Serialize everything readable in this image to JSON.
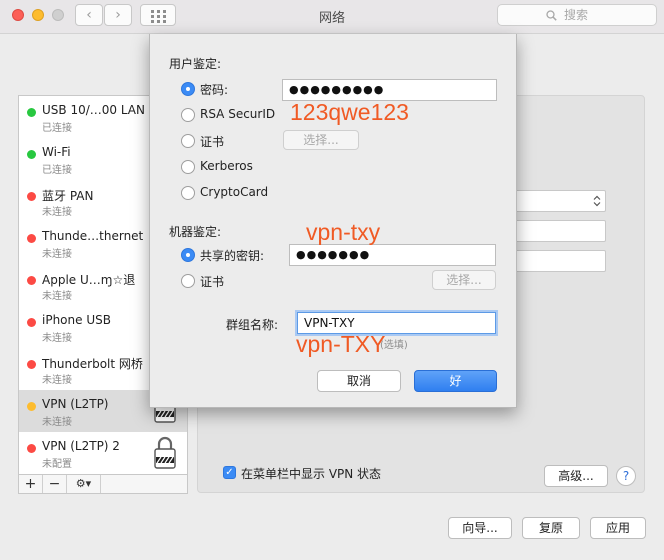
{
  "window": {
    "title": "网络",
    "search_placeholder": "搜索"
  },
  "services": [
    {
      "name": "USB 10/…00 LAN",
      "status": "已连接",
      "color": "#28c840"
    },
    {
      "name": "Wi-Fi",
      "status": "已连接",
      "color": "#28c840"
    },
    {
      "name": "蓝牙 PAN",
      "status": "未连接",
      "color": "#fc4a44"
    },
    {
      "name": "Thunde…thernet",
      "status": "未连接",
      "color": "#fc4a44"
    },
    {
      "name": "Apple U…ɱ☆退",
      "status": "未连接",
      "color": "#fc4a44"
    },
    {
      "name": "iPhone USB",
      "status": "未连接",
      "color": "#fc4a44"
    },
    {
      "name": "Thunderbolt 网桥",
      "status": "未连接",
      "color": "#fc4a44"
    },
    {
      "name": "VPN (L2TP)",
      "status": "未连接",
      "color": "#fdbc2e",
      "selected": true
    },
    {
      "name": "VPN (L2TP) 2",
      "status": "未配置",
      "color": "#fc4a44"
    }
  ],
  "sidebar_tools": {
    "add": "+",
    "remove": "−",
    "gear": "⚙︎▾"
  },
  "sheet": {
    "user_auth_label": "用户鉴定:",
    "user_options": [
      "密码:",
      "RSA SecurID",
      "证书",
      "Kerberos",
      "CryptoCard"
    ],
    "password_value": "●●●●●●●●●",
    "choose_label": "选择...",
    "machine_auth_label": "机器鉴定:",
    "machine_options": [
      "共享的密钥:",
      "证书"
    ],
    "shared_secret_value": "●●●●●●●",
    "group_name_label": "群组名称:",
    "group_name_value": "VPN-TXY",
    "group_name_hint": "(选填)",
    "cancel_label": "取消",
    "ok_label": "好"
  },
  "annotations": {
    "password": "123qwe123",
    "secret": "vpn-txy",
    "group": "vpn-TXY"
  },
  "panel": {
    "show_vpn_status_label": "在菜单栏中显示 VPN 状态",
    "show_vpn_status_checked": true,
    "advanced_label": "高级...",
    "help_label": "?"
  },
  "footer": {
    "assist_label": "向导...",
    "revert_label": "复原",
    "apply_label": "应用"
  }
}
